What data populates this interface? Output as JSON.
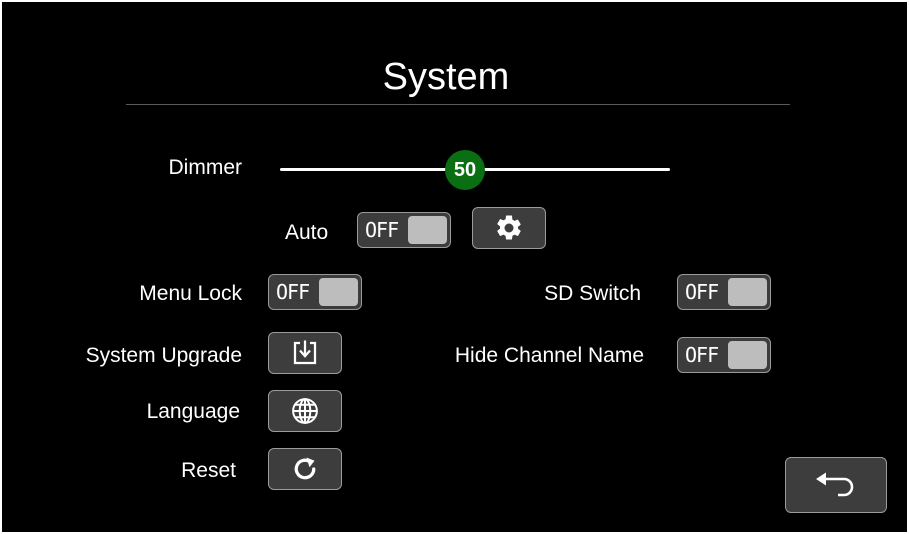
{
  "header": {
    "title": "System"
  },
  "dimmer": {
    "label": "Dimmer",
    "value": "50",
    "level_percent": 50
  },
  "auto": {
    "label": "Auto",
    "toggle_text": "OFF"
  },
  "menu_lock": {
    "label": "Menu Lock",
    "toggle_text": "OFF"
  },
  "sd_switch": {
    "label": "SD Switch",
    "toggle_text": "OFF"
  },
  "system_upgrade": {
    "label": "System Upgrade"
  },
  "hide_channel_name": {
    "label": "Hide Channel Name",
    "toggle_text": "OFF"
  },
  "language": {
    "label": "Language"
  },
  "reset": {
    "label": "Reset"
  },
  "icons": {
    "settings": "gear-icon",
    "upgrade": "download-icon",
    "language": "globe-icon",
    "reset": "refresh-icon",
    "back": "back-arrow-icon"
  },
  "colors": {
    "background": "#000000",
    "slider_knob": "#0a6e12",
    "button_fill": "#3d3d3d",
    "toggle_thumb": "#bdbdbd"
  }
}
